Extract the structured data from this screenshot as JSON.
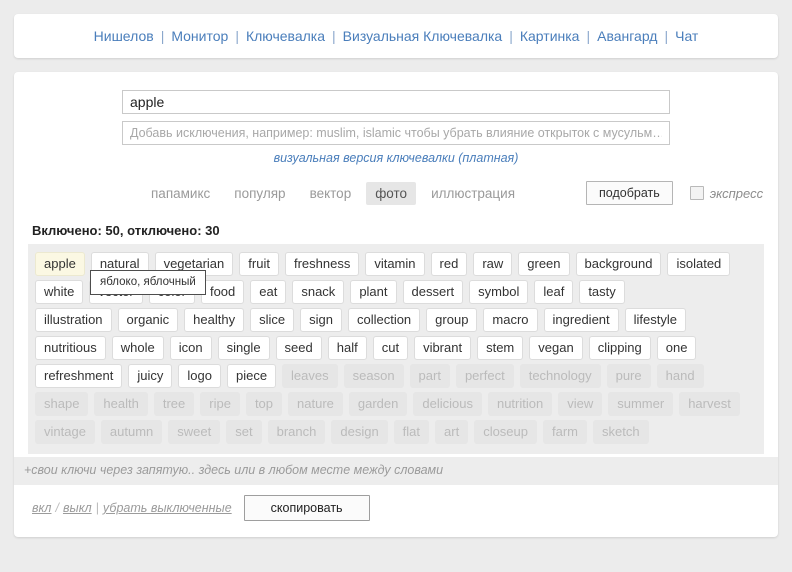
{
  "nav": {
    "separator": "|",
    "links": [
      "Нишелов",
      "Монитор",
      "Ключевалка",
      "Визуальная Ключевалка",
      "Картинка",
      "Авангард",
      "Чат"
    ]
  },
  "search": {
    "query_value": "apple",
    "query_placeholder": "",
    "exclusions_value": "",
    "exclusions_placeholder": "Добавь исключения, например: muslim, islamic чтобы убрать влияние открыток с мусульм…",
    "visual_link": "визуальная версия ключевалки (платная)"
  },
  "filters": {
    "tabs": [
      {
        "label": "папамикс",
        "active": false
      },
      {
        "label": "популяр",
        "active": false
      },
      {
        "label": "вектор",
        "active": false
      },
      {
        "label": "фото",
        "active": true
      },
      {
        "label": "иллюстрация",
        "active": false
      }
    ],
    "pick_button": "подобрать",
    "express_label": "экспресс",
    "express_checked": false
  },
  "counter": "Включено: 50, отключено: 30",
  "tooltip": {
    "text": "яблоко, яблочный",
    "for_tag": "apple"
  },
  "tags": {
    "rows": [
      [
        {
          "label": "apple",
          "enabled": true,
          "hovered": true
        },
        {
          "label": "natural",
          "enabled": true
        },
        {
          "label": "vegetarian",
          "enabled": true
        },
        {
          "label": "fruit",
          "enabled": true
        },
        {
          "label": "freshness",
          "enabled": true
        },
        {
          "label": "vitamin",
          "enabled": true
        },
        {
          "label": "red",
          "enabled": true
        },
        {
          "label": "raw",
          "enabled": true
        },
        {
          "label": "green",
          "enabled": true
        },
        {
          "label": "background",
          "enabled": true
        },
        {
          "label": "isolated",
          "enabled": true
        }
      ],
      [
        {
          "label": "white",
          "enabled": true
        },
        {
          "label": "vector",
          "enabled": true
        },
        {
          "label": "color",
          "enabled": true
        },
        {
          "label": "food",
          "enabled": true
        },
        {
          "label": "eat",
          "enabled": true
        },
        {
          "label": "snack",
          "enabled": true
        },
        {
          "label": "plant",
          "enabled": true
        },
        {
          "label": "dessert",
          "enabled": true
        },
        {
          "label": "symbol",
          "enabled": true
        },
        {
          "label": "leaf",
          "enabled": true
        },
        {
          "label": "tasty",
          "enabled": true
        }
      ],
      [
        {
          "label": "illustration",
          "enabled": true
        },
        {
          "label": "organic",
          "enabled": true
        },
        {
          "label": "healthy",
          "enabled": true
        },
        {
          "label": "slice",
          "enabled": true
        },
        {
          "label": "sign",
          "enabled": true
        },
        {
          "label": "collection",
          "enabled": true
        },
        {
          "label": "group",
          "enabled": true
        },
        {
          "label": "macro",
          "enabled": true
        },
        {
          "label": "ingredient",
          "enabled": true
        },
        {
          "label": "lifestyle",
          "enabled": true
        }
      ],
      [
        {
          "label": "nutritious",
          "enabled": true
        },
        {
          "label": "whole",
          "enabled": true
        },
        {
          "label": "icon",
          "enabled": true
        },
        {
          "label": "single",
          "enabled": true
        },
        {
          "label": "seed",
          "enabled": true
        },
        {
          "label": "half",
          "enabled": true
        },
        {
          "label": "cut",
          "enabled": true
        },
        {
          "label": "vibrant",
          "enabled": true
        },
        {
          "label": "stem",
          "enabled": true
        },
        {
          "label": "vegan",
          "enabled": true
        },
        {
          "label": "clipping",
          "enabled": true
        },
        {
          "label": "one",
          "enabled": true
        }
      ],
      [
        {
          "label": "refreshment",
          "enabled": true
        },
        {
          "label": "juicy",
          "enabled": true
        },
        {
          "label": "logo",
          "enabled": true
        },
        {
          "label": "piece",
          "enabled": true
        },
        {
          "label": "leaves",
          "enabled": false
        },
        {
          "label": "season",
          "enabled": false
        },
        {
          "label": "part",
          "enabled": false
        },
        {
          "label": "perfect",
          "enabled": false
        },
        {
          "label": "technology",
          "enabled": false
        },
        {
          "label": "pure",
          "enabled": false
        },
        {
          "label": "hand",
          "enabled": false
        }
      ],
      [
        {
          "label": "shape",
          "enabled": false
        },
        {
          "label": "health",
          "enabled": false
        },
        {
          "label": "tree",
          "enabled": false
        },
        {
          "label": "ripe",
          "enabled": false
        },
        {
          "label": "top",
          "enabled": false
        },
        {
          "label": "nature",
          "enabled": false
        },
        {
          "label": "garden",
          "enabled": false
        },
        {
          "label": "delicious",
          "enabled": false
        },
        {
          "label": "nutrition",
          "enabled": false
        },
        {
          "label": "view",
          "enabled": false
        },
        {
          "label": "summer",
          "enabled": false
        },
        {
          "label": "harvest",
          "enabled": false
        }
      ],
      [
        {
          "label": "vintage",
          "enabled": false
        },
        {
          "label": "autumn",
          "enabled": false
        },
        {
          "label": "sweet",
          "enabled": false
        },
        {
          "label": "set",
          "enabled": false
        },
        {
          "label": "branch",
          "enabled": false
        },
        {
          "label": "design",
          "enabled": false
        },
        {
          "label": "flat",
          "enabled": false
        },
        {
          "label": "art",
          "enabled": false
        },
        {
          "label": "closeup",
          "enabled": false
        },
        {
          "label": "farm",
          "enabled": false
        },
        {
          "label": "sketch",
          "enabled": false
        }
      ]
    ]
  },
  "hint": "+свои ключи через запятую.. здесь или в любом месте между словами",
  "footer": {
    "on_label": "вкл",
    "slash": "/",
    "off_label": "выкл",
    "pipe": "|",
    "remove_disabled_label": "убрать выключенные",
    "copy_button": "скопировать"
  },
  "colors": {
    "page_background": "#ececec",
    "panel": "#ffffff",
    "link": "#4a7ebb",
    "tag_area": "#ededed",
    "tag_enabled_bg": "#ffffff",
    "tag_disabled_bg": "#e6e6e6",
    "tag_hover_bg": "#fbf8e3",
    "muted_text": "#9b9b9b"
  }
}
